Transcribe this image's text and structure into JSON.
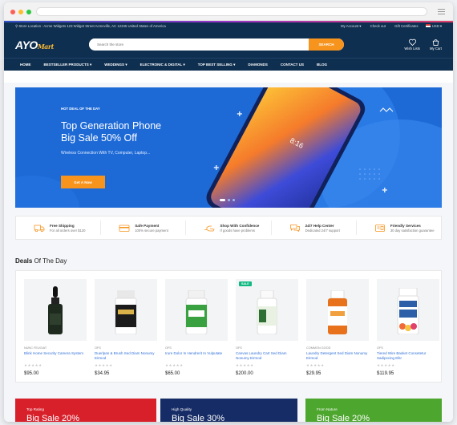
{
  "topbar": {
    "location": "Store Location : Acme Widgets 123 Widget Street Acmeville, AC 12345 United States of America",
    "links": [
      "My Account",
      "Check out",
      "Gift Certificates",
      "USD"
    ]
  },
  "header": {
    "logo_main": "AYO",
    "logo_script": "Mart",
    "search_placeholder": "Search the store",
    "search_button": "SEARCH",
    "wishlist": "Wish Lists",
    "cart": "My Cart"
  },
  "nav": {
    "items": [
      "HOME",
      "BESTSELLER PRODUCTS",
      "WEDDINGS",
      "ELECTRONIC & DIGITAL",
      "TOP BEST SELLING",
      "DIAMONDS",
      "CONTACT US",
      "BLOG"
    ]
  },
  "hero": {
    "kicker": "HOT DEAL OF THE DAY",
    "title_line1": "Top Generation Phone",
    "title_line2": "Big Sale 50% Off",
    "subtitle": "Wireless Connection With TV, Computer, Laptop...",
    "button": "Get A Now",
    "phone_time": "8:16"
  },
  "features": [
    {
      "title": "Free Shipping",
      "desc": "For all orders over $120",
      "icon": "truck-icon"
    },
    {
      "title": "Safe Payment",
      "desc": "100% secure payment",
      "icon": "card-icon"
    },
    {
      "title": "Shop With Confidence",
      "desc": "If goods have problems",
      "icon": "hand-icon"
    },
    {
      "title": "24/7 Help Center",
      "desc": "Dedicated 24/7 support",
      "icon": "chat-icon"
    },
    {
      "title": "Friendly Services",
      "desc": "30 day satisfaction guarantee",
      "icon": "service-icon"
    }
  ],
  "deals": {
    "title_bold": "Deals",
    "title_rest": " Of The Day",
    "products": [
      {
        "brand": "NUNC FEUGIAT",
        "name": "Blink Home Security Camera System",
        "price": "$95.00",
        "sale": "",
        "bottle": "dropper"
      },
      {
        "brand": "OFS",
        "name": "Duerlpan & Brush Sed Diam Nonumy Eirmod",
        "price": "$34.95",
        "sale": "",
        "bottle": "cbd"
      },
      {
        "brand": "OFS",
        "name": "Irure Dolor In Hendrerit In Vulputate",
        "price": "$65.00",
        "sale": "",
        "bottle": "green"
      },
      {
        "brand": "OFS",
        "name": "Canvas Laundry Cart Sed Diam Nonumy Eirmod",
        "price": "$200.00",
        "sale": "SALE",
        "bottle": "white"
      },
      {
        "brand": "COMMON GOOD",
        "name": "Laundry Detergent Sed Diam Nonumy Eirmod",
        "price": "$29.95",
        "sale": "",
        "bottle": "orange"
      },
      {
        "brand": "OFS",
        "name": "Tiered Wire Basket Consetetur Sadipscing Elitr",
        "price": "$119.95",
        "sale": "",
        "bottle": "gummy"
      }
    ]
  },
  "banners": [
    {
      "kicker": "Top Rating",
      "headline": "Big Sale 20%",
      "color": "#d8202b"
    },
    {
      "kicker": "High Quality",
      "headline": "Big Sale 30%",
      "color": "#162c66"
    },
    {
      "kicker": "From Nature",
      "headline": "Big Sale 20%",
      "color": "#4da62e"
    }
  ],
  "colors": {
    "navy": "#0f2f50",
    "accent": "#f7941d",
    "hero": "#1d6ad7",
    "link": "#3170d8"
  }
}
